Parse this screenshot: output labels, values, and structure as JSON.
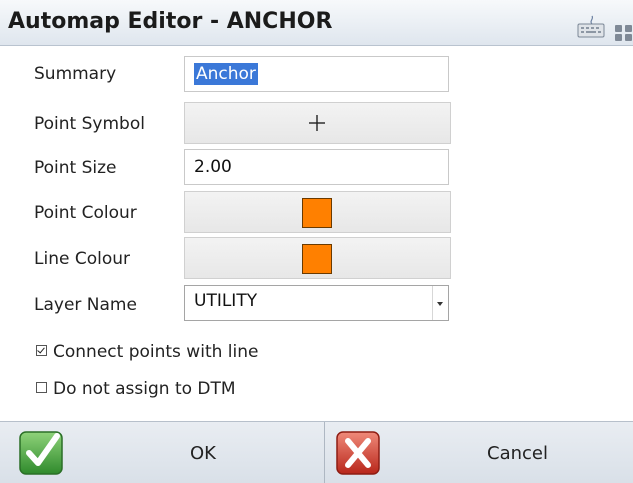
{
  "window": {
    "title": "Automap Editor - ANCHOR",
    "icons": [
      "keyboard-icon",
      "grid-icon"
    ]
  },
  "form": {
    "summary": {
      "label": "Summary",
      "value": "Anchor"
    },
    "point_symbol": {
      "label": "Point Symbol",
      "symbol": "plus-icon"
    },
    "point_size": {
      "label": "Point Size",
      "value": "2.00"
    },
    "point_colour": {
      "label": "Point Colour",
      "color": "#ff8000"
    },
    "line_colour": {
      "label": "Line Colour",
      "color": "#ff8000"
    },
    "layer_name": {
      "label": "Layer Name",
      "value": "UTILITY"
    },
    "connect_points": {
      "label": "Connect points with line",
      "checked": true
    },
    "no_dtm": {
      "label": "Do not assign to DTM",
      "checked": false
    }
  },
  "buttons": {
    "ok": {
      "label": "OK",
      "icon": "checkmark-icon",
      "color": "#3aa33a"
    },
    "cancel": {
      "label": "Cancel",
      "icon": "x-icon",
      "color": "#d83a2a"
    }
  }
}
